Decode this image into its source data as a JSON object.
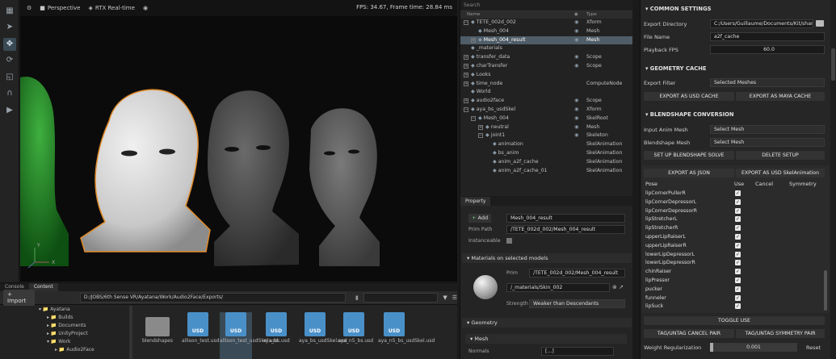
{
  "viewport": {
    "camera": "Perspective",
    "renderer": "RTX Real-time",
    "fps_text": "FPS: 34.67, Frame time: 28.84 ms",
    "axis_y": "Y",
    "axis_x": "X"
  },
  "content": {
    "tabs": [
      "Console",
      "Content"
    ],
    "import_label": "Import",
    "path": "D:/JOBS/6th Sense VR/Ayatana/Work/Audio2Face/Exports/",
    "tree": [
      "Ayatana",
      "Builds",
      "Documents",
      "UnityProject",
      "Work",
      "Audio2Face"
    ],
    "files": [
      {
        "name": "blendshapes",
        "kind": "folder"
      },
      {
        "name": "allison_test.usd",
        "kind": "usd"
      },
      {
        "name": "allison_test_usdSkel.usd",
        "kind": "usd"
      },
      {
        "name": "aya_bs.usd",
        "kind": "usd"
      },
      {
        "name": "aya_bs_usdSkel.usd",
        "kind": "usd"
      },
      {
        "name": "aya_n5_bs.usd",
        "kind": "usd"
      },
      {
        "name": "aya_n5_bs_usdSkel.usd",
        "kind": "usd"
      }
    ]
  },
  "stage": {
    "search_placeholder": "Search",
    "col_name": "Name",
    "col_type": "Type",
    "rows": [
      {
        "name": "TETE_002d_002",
        "type": "Xform",
        "indent": 0,
        "exp": "−",
        "eye": true
      },
      {
        "name": "Mesh_004",
        "type": "Mesh",
        "indent": 1,
        "exp": "",
        "eye": true
      },
      {
        "name": "Mesh_004_result",
        "type": "Mesh",
        "indent": 1,
        "exp": "+",
        "eye": true,
        "selected": true
      },
      {
        "name": "_materials",
        "type": "",
        "indent": 0,
        "exp": "",
        "eye": false
      },
      {
        "name": "transfer_data",
        "type": "Scope",
        "indent": 0,
        "exp": "+",
        "eye": true
      },
      {
        "name": "charTransfer",
        "type": "Scope",
        "indent": 0,
        "exp": "+",
        "eye": true
      },
      {
        "name": "Looks",
        "type": "",
        "indent": 0,
        "exp": "+",
        "eye": false
      },
      {
        "name": "time_node",
        "type": "ComputeNode",
        "indent": 0,
        "exp": "+",
        "eye": false
      },
      {
        "name": "World",
        "type": "",
        "indent": 0,
        "exp": "",
        "eye": false
      },
      {
        "name": "audio2face",
        "type": "Scope",
        "indent": 0,
        "exp": "+",
        "eye": true
      },
      {
        "name": "aya_bs_usdSkel",
        "type": "Xform",
        "indent": 0,
        "exp": "−",
        "eye": true
      },
      {
        "name": "Mesh_004",
        "type": "SkelRoot",
        "indent": 1,
        "exp": "−",
        "eye": true
      },
      {
        "name": "neutral",
        "type": "Mesh",
        "indent": 2,
        "exp": "+",
        "eye": true
      },
      {
        "name": "joint1",
        "type": "Skeleton",
        "indent": 2,
        "exp": "−",
        "eye": true
      },
      {
        "name": "animation",
        "type": "SkelAnimation",
        "indent": 3,
        "exp": "",
        "eye": false
      },
      {
        "name": "bs_anim",
        "type": "SkelAnimation",
        "indent": 3,
        "exp": "",
        "eye": false
      },
      {
        "name": "anim_a2f_cache",
        "type": "SkelAnimation",
        "indent": 3,
        "exp": "",
        "eye": false
      },
      {
        "name": "anim_a2f_cache_01",
        "type": "SkelAnimation",
        "indent": 3,
        "exp": "",
        "eye": false
      }
    ]
  },
  "property": {
    "tab": "Property",
    "add_label": "Add",
    "name_value": "Mesh_004_result",
    "prim_path_label": "Prim Path",
    "prim_path_value": "/TETE_002d_002/Mesh_004_result",
    "instanceable_label": "Instanceable",
    "materials_section": "Materials on selected models",
    "prim_label": "Prim",
    "prim_value": "/TETE_002d_002/Mesh_004_result",
    "material_value": "/_materials/Skin_002",
    "strength_label": "Strength",
    "strength_value": "Weaker than Descendants",
    "geometry_section": "Geometry",
    "mesh_section": "Mesh",
    "normals_label": "Normals",
    "normals_value": "[...]"
  },
  "export": {
    "common_section": "COMMON SETTINGS",
    "export_dir_label": "Export Directory",
    "export_dir_value": "C:/Users/Guillaume/Documents/Kit/shared",
    "filename_label": "File Name",
    "filename_value": "a2f_cache",
    "fps_label": "Playback FPS",
    "fps_value": "60.0",
    "geo_section": "GEOMETRY CACHE",
    "filter_label": "Export Filter",
    "filter_value": "Selected Meshes",
    "export_usd_cache": "EXPORT AS USD CACHE",
    "export_maya_cache": "EXPORT AS MAYA CACHE",
    "bs_section": "BLENDSHAPE CONVERSION",
    "input_mesh_label": "Input Anim Mesh",
    "input_mesh_value": "Select Mesh",
    "bs_mesh_label": "Blendshape Mesh",
    "bs_mesh_value": "Select Mesh",
    "setup_solve": "SET UP BLENDSHAPE SOLVE",
    "delete_setup": "DELETE SETUP",
    "export_json": "EXPORT AS JSON",
    "export_skel": "EXPORT AS USD SkelAnimation",
    "pose_headers": {
      "pose": "Pose",
      "use": "Use",
      "cancel": "Cancel",
      "symmetry": "Symmetry"
    },
    "poses": [
      "lipCornerPullerR",
      "lipCornerDepressorL",
      "lipCornerDepressorR",
      "lipStretcherL",
      "lipStretcherR",
      "upperLipRaiserL",
      "upperLipRaiserR",
      "lowerLipDepressorL",
      "lowerLipDepressorR",
      "chinRaiser",
      "lipPressor",
      "pucker",
      "funneler",
      "lipSuck"
    ],
    "toggle_use": "TOGGLE USE",
    "tag_cancel": "TAG/UNTAG CANCEL PAIR",
    "tag_symmetry": "TAG/UNTAG SYMMETRY PAIR",
    "weight_reg_label": "Weight Regularization",
    "weight_reg_value": "0.001",
    "reset_label": "Reset"
  },
  "colors": {
    "accent_orange": "#e08a2a",
    "selection": "#4f5d68",
    "usd_blue": "#4a90c8"
  }
}
